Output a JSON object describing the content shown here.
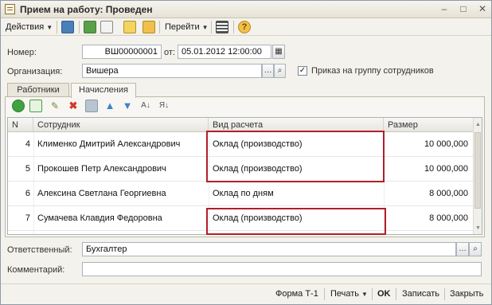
{
  "window": {
    "title": "Прием на работу: Проведен",
    "controls": [
      "minimize",
      "maximize",
      "close"
    ]
  },
  "toolbar": {
    "actions_label": "Действия",
    "goto_label": "Перейти",
    "help_label": "?"
  },
  "form": {
    "number_label": "Номер:",
    "number_value": "ВШ00000001",
    "date_from_label": "от:",
    "date_value": "05.01.2012 12:00:00",
    "org_label": "Организация:",
    "org_value": "Вишера",
    "group_order_label": "Приказ на группу сотрудников",
    "group_order_checked": true
  },
  "tabs": [
    {
      "label": "Работники",
      "active": false
    },
    {
      "label": "Начисления",
      "active": true
    }
  ],
  "grid": {
    "columns": [
      "N",
      "Сотрудник",
      "Вид расчета",
      "Размер"
    ],
    "rows": [
      {
        "n": "4",
        "employee": "Клименко Дмитрий Александрович",
        "calc_type": "Оклад (производство)",
        "amount": "10 000,000",
        "highlighted": true
      },
      {
        "n": "5",
        "employee": "Прокошев Петр Александрович",
        "calc_type": "Оклад (производство)",
        "amount": "10 000,000",
        "highlighted": true
      },
      {
        "n": "6",
        "employee": "Алексина Светлана Георгиевна",
        "calc_type": "Оклад по дням",
        "amount": "8 000,000",
        "highlighted": false
      },
      {
        "n": "7",
        "employee": "Сумачева Клавдия Федоровна",
        "calc_type": "Оклад (производство)",
        "amount": "8 000,000",
        "highlighted": true
      }
    ]
  },
  "footer_fields": {
    "responsible_label": "Ответственный:",
    "responsible_value": "Бухгалтер",
    "comment_label": "Комментарий:",
    "comment_value": ""
  },
  "bottom_bar": {
    "form_label": "Форма Т-1",
    "print_label": "Печать",
    "ok_label": "OK",
    "save_label": "Записать",
    "close_label": "Закрыть"
  },
  "colors": {
    "highlight_border": "#b21e2a",
    "add_icon": "#3fa33f",
    "delete_icon": "#d23a2a",
    "up_icon": "#3f83c9"
  }
}
